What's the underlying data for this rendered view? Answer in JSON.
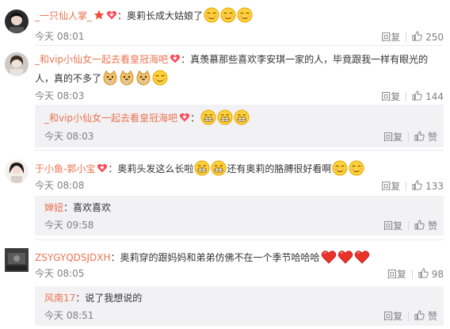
{
  "colors": {
    "username": "#eb7350",
    "meta": "#808080",
    "reply_bg": "#f2f2f5",
    "text": "#333333"
  },
  "comments": [
    {
      "user": "_一只仙人掌_",
      "text": "：奥莉长成大姑娘了",
      "time": "今天 08:01",
      "reply_label": "回复",
      "likes": "250",
      "emojis": [
        "meh-face-icon",
        "meh-face-icon",
        "meh-face-icon"
      ]
    },
    {
      "user": "_和vip小仙女一起去看皇冠海吧",
      "text": "：真羡慕那些喜欢李安琪一家的人，毕竟跟我一样有眼光的人，真的不多了",
      "time": "今天 08:03",
      "reply_label": "回复",
      "likes": "144",
      "emojis": [
        "doge-icon",
        "doge-icon",
        "doge-icon",
        "meh-face-icon"
      ],
      "sub_reply": {
        "user": "_和vip小仙女一起去看皇冠海吧",
        "text": "：",
        "time": "今天 08:03",
        "reply_label": "回复",
        "like_label": "赞",
        "emojis": [
          "grin-face-icon",
          "grin-face-icon",
          "grin-face-icon"
        ]
      }
    },
    {
      "user": "于小鱼-郭小宝",
      "text_a": "：奥莉头发这么长啦",
      "text_b": "还有奥莉的胳膊很好看啊",
      "time": "今天 08:08",
      "reply_label": "回复",
      "likes": "133",
      "sub_reply": {
        "user": "婵妞",
        "text": "：喜欢喜欢",
        "time": "今天 09:58",
        "reply_label": "回复",
        "like_label": "赞"
      }
    },
    {
      "user": "ZSYGYQDSJDXH",
      "text": "：奥莉穿的跟妈妈和弟弟仿佛不在一个季节哈哈哈",
      "time": "今天 08:05",
      "reply_label": "回复",
      "likes": "98",
      "emojis": [
        "heart-icon",
        "heart-icon",
        "heart-icon"
      ],
      "sub_reply": {
        "user": "风南17",
        "text": "：说了我想说的",
        "time": "今天 08:51",
        "reply_label": "回复",
        "like_label": "赞"
      }
    }
  ]
}
